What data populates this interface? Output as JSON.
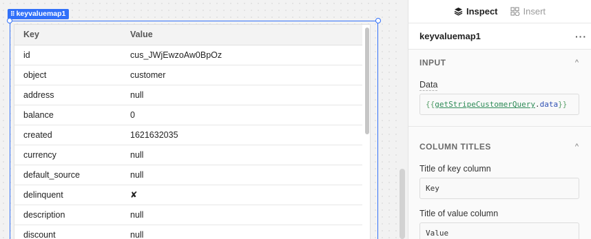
{
  "component": {
    "name": "keyvaluemap1"
  },
  "table": {
    "headers": {
      "key": "Key",
      "value": "Value"
    },
    "rows": [
      {
        "key": "id",
        "value": "cus_JWjEwzoAw0BpOz"
      },
      {
        "key": "object",
        "value": "customer"
      },
      {
        "key": "address",
        "value": "null"
      },
      {
        "key": "balance",
        "value": "0"
      },
      {
        "key": "created",
        "value": "1621632035"
      },
      {
        "key": "currency",
        "value": "null"
      },
      {
        "key": "default_source",
        "value": "null"
      },
      {
        "key": "delinquent",
        "value": "✘"
      },
      {
        "key": "description",
        "value": "null"
      },
      {
        "key": "discount",
        "value": "null"
      }
    ]
  },
  "panel": {
    "tabs": {
      "inspect": "Inspect",
      "insert": "Insert"
    },
    "more": "···",
    "input_section": {
      "title": "INPUT",
      "data_label": "Data",
      "data_code": {
        "open": "{{",
        "ident": "getStripeCustomerQuery",
        "dot": ".",
        "prop": "data",
        "close": "}}"
      }
    },
    "column_titles": {
      "title": "COLUMN TITLES",
      "key_label": "Title of key column",
      "key_value": "Key",
      "value_label": "Title of value column",
      "value_value": "Value"
    }
  },
  "colors": {
    "selection": "#3170f9",
    "code_green": "#2e8b57",
    "code_blue": "#2d4fb3"
  },
  "icons": [
    "drag-grip-icon",
    "inspect-icon",
    "insert-icon",
    "chevron-up-icon",
    "more-icon"
  ]
}
